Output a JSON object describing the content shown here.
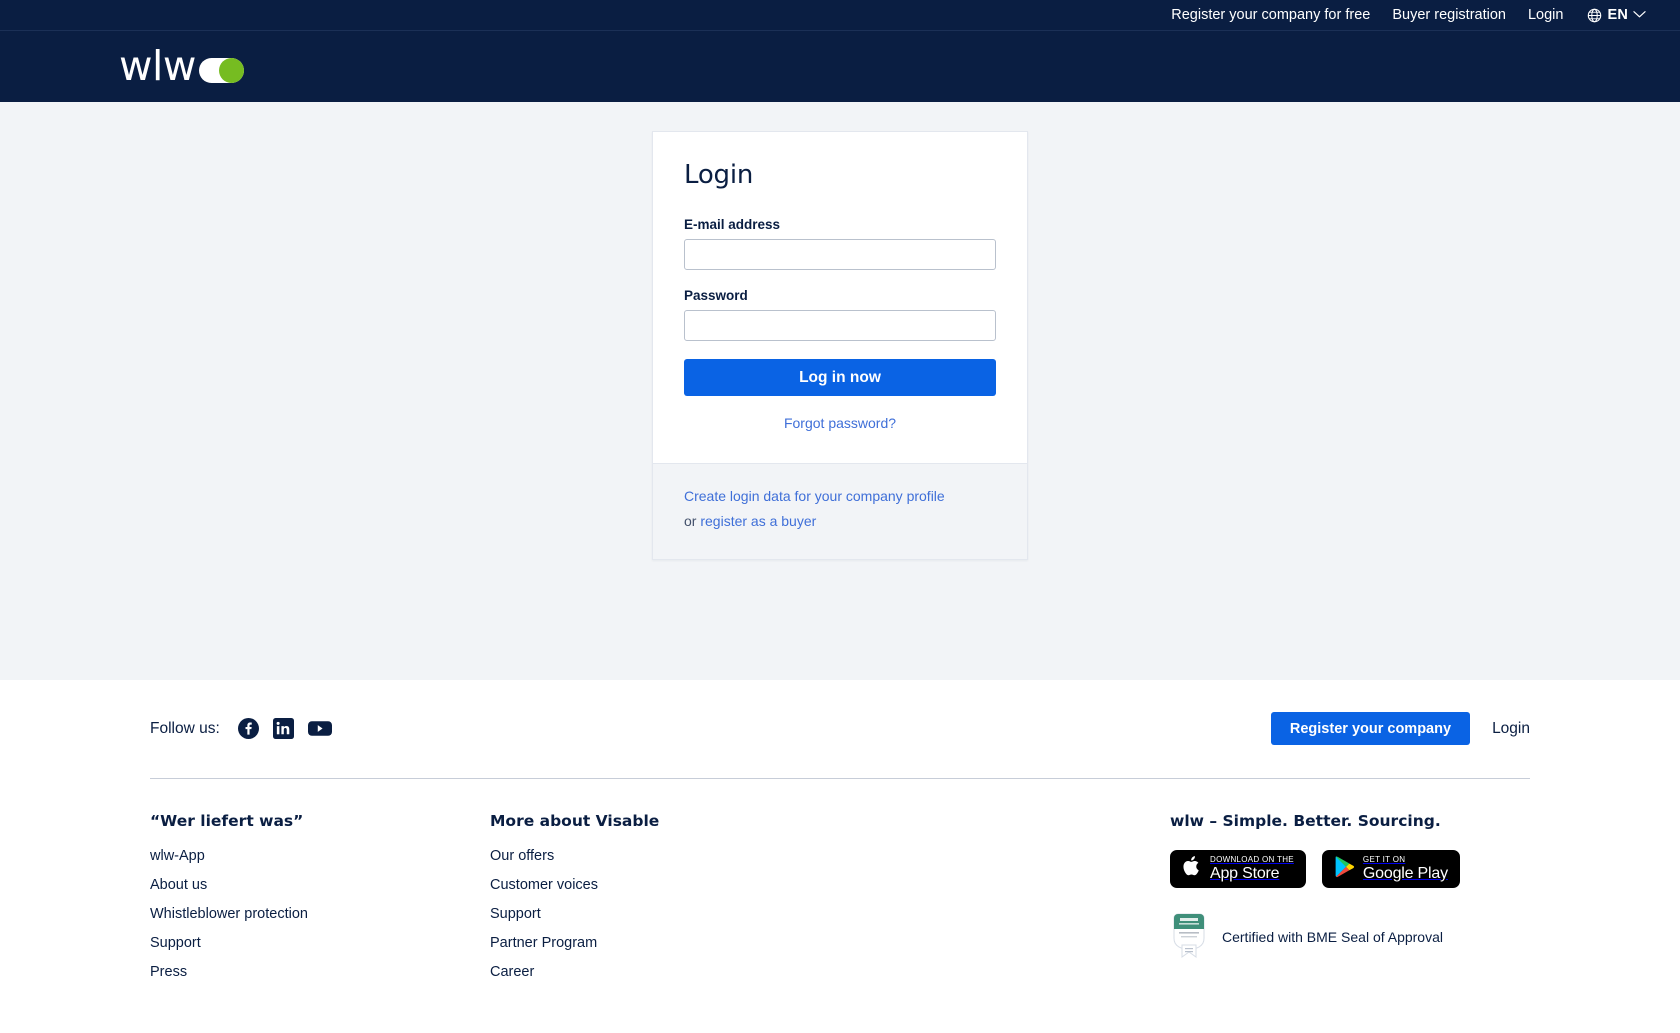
{
  "topbar": {
    "links": [
      {
        "label": "Register your company for free",
        "name": "register-company-free"
      },
      {
        "label": "Buyer registration",
        "name": "buyer-registration"
      },
      {
        "label": "Login",
        "name": "login"
      }
    ],
    "language": {
      "code": "EN",
      "icon": "globe-icon",
      "chevron": "chevron-down-icon"
    }
  },
  "masthead": {
    "logo_text": "wlw",
    "logo_dot_color": "#76bc21",
    "brand_bg": "#0a1e42"
  },
  "login_card": {
    "title": "Login",
    "email_label": "E-mail address",
    "email_value": "",
    "email_placeholder": "",
    "password_label": "Password",
    "password_value": "",
    "password_placeholder": "",
    "submit_label": "Log in now",
    "forgot_label": "Forgot password?",
    "footer_link_1": "Create login data for your company profile",
    "footer_or": "or ",
    "footer_link_2": "register as a buyer",
    "accent_color": "#0a63e4",
    "link_color": "#3f6fd8"
  },
  "footer": {
    "follow_label": "Follow us:",
    "social": [
      {
        "name": "facebook-icon",
        "label": "Facebook"
      },
      {
        "name": "linkedin-icon",
        "label": "LinkedIn"
      },
      {
        "name": "youtube-icon",
        "label": "YouTube"
      }
    ],
    "register_button": "Register your company",
    "login_link": "Login",
    "col1": {
      "title": "“Wer liefert was”",
      "links": [
        "wlw-App",
        "About us",
        "Whistleblower protection",
        "Support",
        "Press"
      ]
    },
    "col2": {
      "title": "More about Visable",
      "links": [
        "Our offers",
        "Customer voices",
        "Support",
        "Partner Program",
        "Career"
      ]
    },
    "col3": {
      "tagline": "wlw – Simple. Better. Sourcing.",
      "app_store": {
        "small": "Download on the",
        "big": "App Store",
        "icon": "apple-icon"
      },
      "google_play": {
        "small": "Get it on",
        "big": "Google Play",
        "icon": "google-play-icon"
      },
      "seal_text": "Certified with BME Seal of Approval",
      "seal_icon": "bme-seal-icon"
    }
  }
}
